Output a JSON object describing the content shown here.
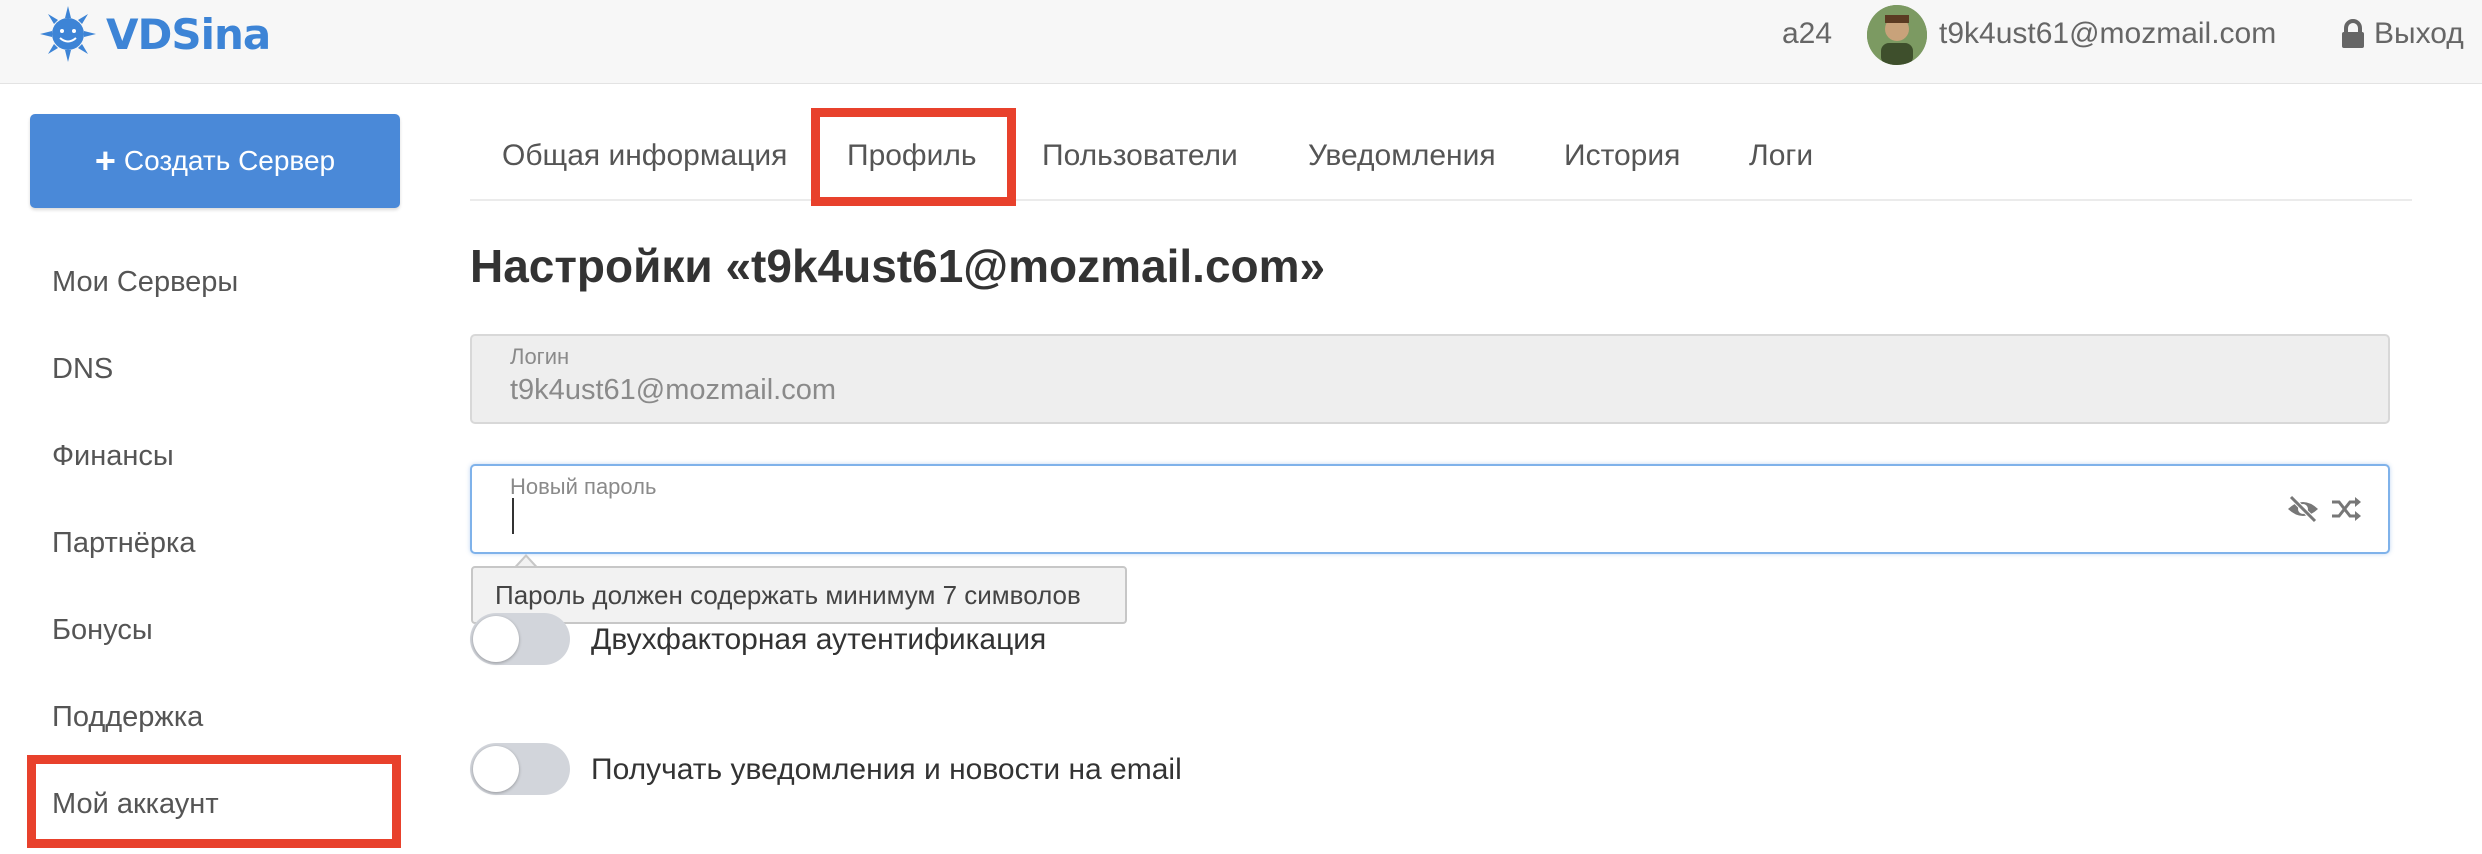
{
  "header": {
    "logo_text": "VDSina",
    "account_code": "a24",
    "user_email": "t9k4ust61@mozmail.com",
    "logout_label": "Выход"
  },
  "sidebar": {
    "create_button": "Создать Сервер",
    "items": [
      {
        "label": "Мои Серверы"
      },
      {
        "label": "DNS"
      },
      {
        "label": "Финансы"
      },
      {
        "label": "Партнёрка"
      },
      {
        "label": "Бонусы"
      },
      {
        "label": "Поддержка"
      },
      {
        "label": "Мой аккаунт"
      }
    ]
  },
  "tabs": [
    {
      "label": "Общая информация"
    },
    {
      "label": "Профиль"
    },
    {
      "label": "Пользователи"
    },
    {
      "label": "Уведомления"
    },
    {
      "label": "История"
    },
    {
      "label": "Логи"
    }
  ],
  "main": {
    "title": "Настройки «t9k4ust61@mozmail.com»",
    "login_label": "Логин",
    "login_value": "t9k4ust61@mozmail.com",
    "password_label": "Новый пароль",
    "password_value": "",
    "password_hint": "Пароль должен содержать минимум 7 символов",
    "two_factor_label": "Двухфакторная аутентификация",
    "two_factor_enabled": false,
    "email_news_label": "Получать уведомления и новости на email",
    "email_news_enabled": false
  },
  "colors": {
    "accent": "#4a89d8",
    "highlight": "#e8412c",
    "logo": "#3d84d6"
  }
}
